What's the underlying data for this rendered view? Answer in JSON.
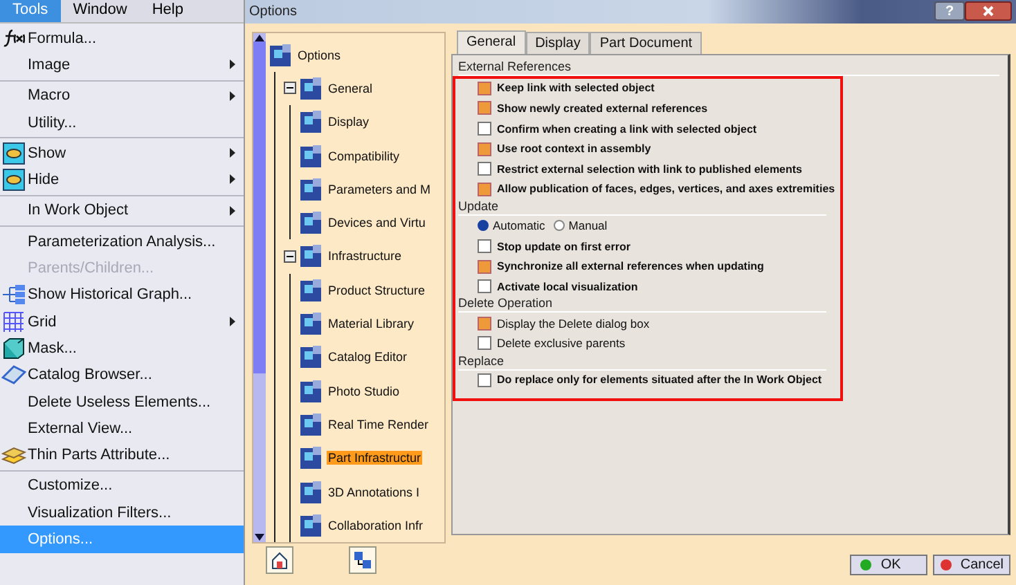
{
  "menubar": [
    {
      "label": "Tools",
      "selected": true
    },
    {
      "label": "Window",
      "selected": false
    },
    {
      "label": "Help",
      "selected": false
    }
  ],
  "menu": {
    "groups": [
      {
        "items": [
          {
            "label": "Formula...",
            "submenu": false,
            "disabled": false,
            "selected": false
          },
          {
            "label": "Image",
            "submenu": true,
            "disabled": false,
            "selected": false
          }
        ]
      },
      {
        "items": [
          {
            "label": "Macro",
            "submenu": true,
            "disabled": false,
            "selected": false
          },
          {
            "label": "Utility...",
            "submenu": false,
            "disabled": false,
            "selected": false
          }
        ]
      },
      {
        "items": [
          {
            "label": "Show",
            "submenu": true,
            "disabled": false,
            "selected": false
          },
          {
            "label": "Hide",
            "submenu": true,
            "disabled": false,
            "selected": false
          }
        ]
      },
      {
        "items": [
          {
            "label": "In Work Object",
            "submenu": true,
            "disabled": false,
            "selected": false
          }
        ]
      },
      {
        "items": [
          {
            "label": "Parameterization Analysis...",
            "submenu": false,
            "disabled": false,
            "selected": false
          },
          {
            "label": "Parents/Children...",
            "submenu": false,
            "disabled": true,
            "selected": false
          },
          {
            "label": "Show Historical Graph...",
            "submenu": false,
            "disabled": false,
            "selected": false
          },
          {
            "label": "Grid",
            "submenu": true,
            "disabled": false,
            "selected": false
          },
          {
            "label": "Mask...",
            "submenu": false,
            "disabled": false,
            "selected": false
          },
          {
            "label": "Catalog Browser...",
            "submenu": false,
            "disabled": false,
            "selected": false
          },
          {
            "label": "Delete Useless Elements...",
            "submenu": false,
            "disabled": false,
            "selected": false
          },
          {
            "label": "External View...",
            "submenu": false,
            "disabled": false,
            "selected": false
          },
          {
            "label": "Thin Parts Attribute...",
            "submenu": false,
            "disabled": false,
            "selected": false
          }
        ]
      },
      {
        "items": [
          {
            "label": "Customize...",
            "submenu": false,
            "disabled": false,
            "selected": false
          },
          {
            "label": "Visualization Filters...",
            "submenu": false,
            "disabled": false,
            "selected": false
          },
          {
            "label": "Options...",
            "submenu": false,
            "disabled": false,
            "selected": true
          }
        ]
      }
    ]
  },
  "window": {
    "title": "Options",
    "help_button": "?",
    "tree": {
      "label": "Options",
      "selected": false,
      "children": [
        {
          "label": "General",
          "expanded": true,
          "selected": false,
          "children": [
            {
              "label": "Display",
              "selected": false
            },
            {
              "label": "Compatibility",
              "selected": false
            },
            {
              "label": "Parameters and M",
              "selected": false
            },
            {
              "label": "Devices and Virtu",
              "selected": false
            }
          ]
        },
        {
          "label": "Infrastructure",
          "expanded": true,
          "selected": false,
          "children": [
            {
              "label": "Product Structure",
              "selected": false
            },
            {
              "label": "Material Library",
              "selected": false
            },
            {
              "label": "Catalog Editor",
              "selected": false
            },
            {
              "label": "Photo Studio",
              "selected": false
            },
            {
              "label": "Real Time Render",
              "selected": false
            },
            {
              "label": "Part Infrastructur",
              "selected": true
            },
            {
              "label": "3D Annotations I",
              "selected": false
            },
            {
              "label": "Collaboration Infr",
              "selected": false
            }
          ]
        }
      ]
    },
    "tabs": [
      {
        "label": "General",
        "selected": true
      },
      {
        "label": "Display",
        "selected": false
      },
      {
        "label": "Part Document",
        "selected": false
      }
    ],
    "sections": [
      {
        "title": "External References",
        "items": [
          {
            "kind": "checkbox",
            "label": "Keep link with selected object",
            "checked": true,
            "bold": true
          },
          {
            "kind": "checkbox",
            "label": "Show newly created external references",
            "checked": true,
            "bold": true
          },
          {
            "kind": "checkbox",
            "label": "Confirm when creating a link with selected object",
            "checked": false,
            "bold": true
          },
          {
            "kind": "checkbox",
            "label": "Use root context in assembly",
            "checked": true,
            "bold": true
          },
          {
            "kind": "checkbox",
            "label": "Restrict external selection with link to published elements",
            "checked": false,
            "bold": true
          },
          {
            "kind": "checkbox",
            "label": "Allow publication of faces, edges, vertices, and axes extremities",
            "checked": true,
            "bold": true
          }
        ]
      },
      {
        "title": "Update",
        "items": [
          {
            "kind": "radio",
            "options": [
              {
                "label": "Automatic",
                "selected": true
              },
              {
                "label": "Manual",
                "selected": false
              }
            ]
          },
          {
            "kind": "checkbox",
            "label": "Stop update on first error",
            "checked": false,
            "bold": true
          },
          {
            "kind": "checkbox",
            "label": "Synchronize all external references when updating",
            "checked": true,
            "bold": true
          },
          {
            "kind": "checkbox",
            "label": "Activate local visualization",
            "checked": false,
            "bold": true
          }
        ]
      },
      {
        "title": "Delete Operation",
        "items": [
          {
            "kind": "checkbox",
            "label": "Display the Delete dialog box",
            "checked": true,
            "bold": false
          },
          {
            "kind": "checkbox",
            "label": "Delete exclusive parents",
            "checked": false,
            "bold": false
          }
        ]
      },
      {
        "title": "Replace",
        "items": [
          {
            "kind": "checkbox",
            "label": "Do replace only for elements situated after the In Work Object",
            "checked": false,
            "bold": true
          }
        ]
      }
    ],
    "buttons": [
      {
        "kind": "ok",
        "label": "OK"
      },
      {
        "kind": "cancel",
        "label": "Cancel"
      }
    ]
  }
}
